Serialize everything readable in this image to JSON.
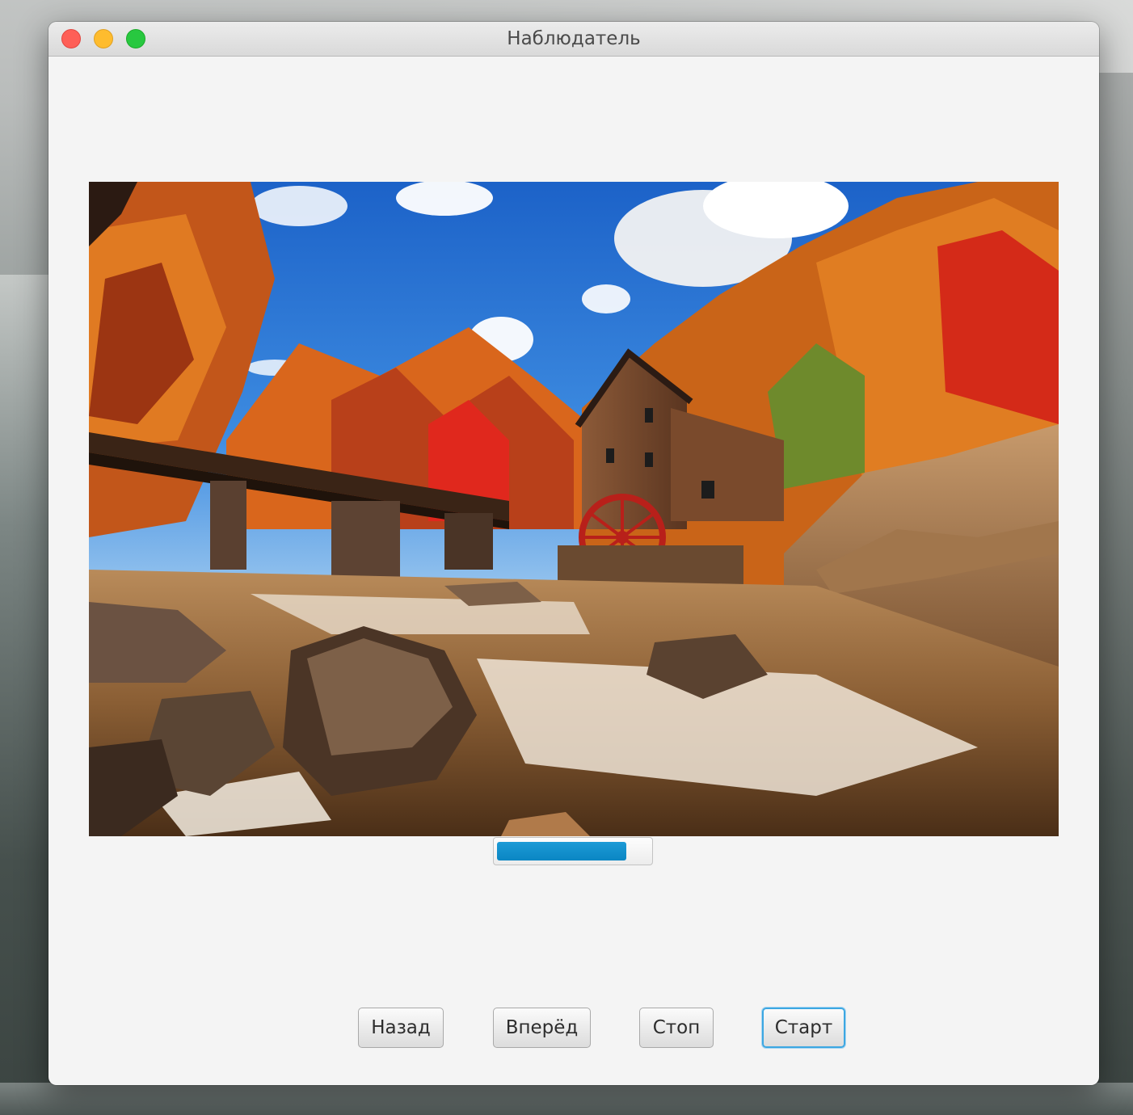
{
  "window": {
    "title": "Наблюдатель"
  },
  "viewer": {
    "image_description_icon": "photo-of-autumn-watermill"
  },
  "progress": {
    "value": 0.85
  },
  "buttons": {
    "back": "Назад",
    "forward": "Вперёд",
    "stop": "Стоп",
    "start": "Старт"
  },
  "colors": {
    "accent": "#0a86c3",
    "focus_ring": "#3ca7e2",
    "window_bg": "#f4f4f4"
  }
}
